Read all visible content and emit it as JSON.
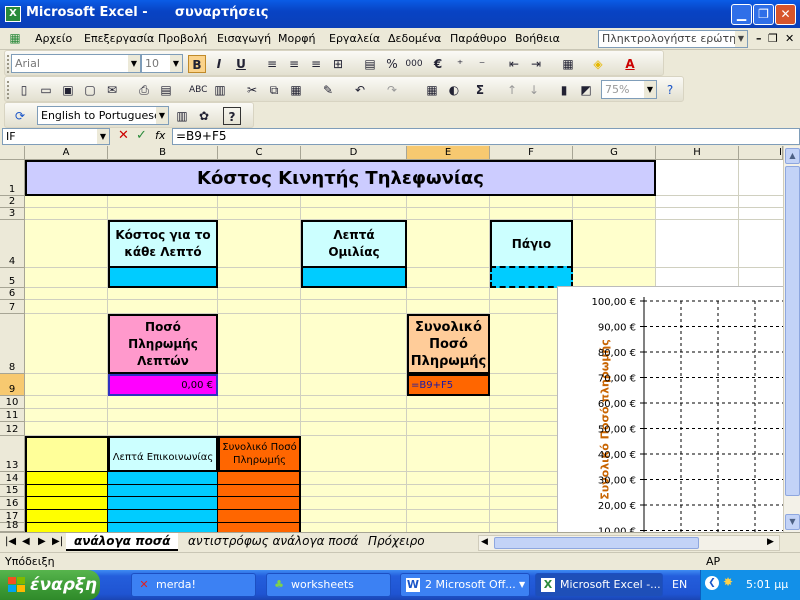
{
  "window": {
    "title": "Microsoft Excel -      συναρτήσεις",
    "app_icon": "X"
  },
  "menu": {
    "items": [
      "Αρχείο",
      "Επεξεργασία",
      "Προβολή",
      "Εισαγωγή",
      "Μορφή",
      "Εργαλεία",
      "Δεδομένα",
      "Παράθυρο",
      "Βοήθεια"
    ],
    "help_placeholder": "Πληκτρολογήστε ερώτηση"
  },
  "formatting": {
    "font": "Arial",
    "size": "10",
    "bold": "B",
    "italic": "I",
    "underline": "U",
    "percent": "%",
    "thousands": "000",
    "euro": "€"
  },
  "standard": {
    "zoom": "75%",
    "sum": "Σ"
  },
  "translate": {
    "label": "English to Portuguese"
  },
  "formula_bar": {
    "name_box": "IF",
    "cancel": "✕",
    "enter": "✓",
    "fx": "fx",
    "formula": "=B9+F5"
  },
  "columns": [
    "A",
    "B",
    "C",
    "D",
    "E",
    "F",
    "G",
    "H",
    "I"
  ],
  "rows": [
    "1",
    "2",
    "3",
    "4",
    "5",
    "6",
    "7",
    "8",
    "9",
    "10",
    "11",
    "12",
    "13",
    "14",
    "15",
    "16",
    "17",
    "18"
  ],
  "sheet": {
    "title": "Κόστος Κινητής Τηλεφωνίας",
    "cost_per_minute": "Κόστος για το κάθε Λεπτό",
    "talk_minutes": "Λεπτά Ομιλίας",
    "fixed_fee": "Πάγιο",
    "minutes_payment": "Ποσό Πληρωμής Λεπτών",
    "minutes_payment_value": "0,00 €",
    "total_payment": "Συνολικό Ποσό Πληρωμής",
    "editing_formula": "=B9+F5",
    "comm_minutes_header": "Λεπτά Επικοινωνίας",
    "total_payment_header": "Συνολικό Ποσό Πληρωμής"
  },
  "chart_data": {
    "type": "line",
    "ylabel": "Συνολικό Ποσό πληρωμής",
    "yticks": [
      "100,00 €",
      "90,00 €",
      "80,00 €",
      "70,00 €",
      "60,00 €",
      "50,00 €",
      "40,00 €",
      "30,00 €",
      "20,00 €",
      "10,00 €"
    ],
    "ylim": [
      10,
      100
    ],
    "grid": true,
    "series": []
  },
  "tabs": {
    "items": [
      "ανάλογα ποσά",
      "αντιστρόφως ανάλογα ποσά",
      "Πρόχειρο"
    ],
    "active": "ανάλογα ποσά"
  },
  "status": {
    "left": "Υπόδειξη",
    "right": "AP"
  },
  "taskbar": {
    "start": "έναρξη",
    "tasks": [
      "merda!",
      "worksheets",
      "2 Microsoft Off...",
      "Microsoft Excel -..."
    ],
    "lang": "EN",
    "clock": "5:01 μμ"
  },
  "colors": {
    "title_fill": "#ccccff",
    "cyan": "#00ccff",
    "magenta": "#ff00ff",
    "orange": "#ff6600",
    "pink": "#ff99cc",
    "peach": "#ffcc99",
    "yellow": "#ffff00",
    "light_yellow": "#ffffcc"
  }
}
